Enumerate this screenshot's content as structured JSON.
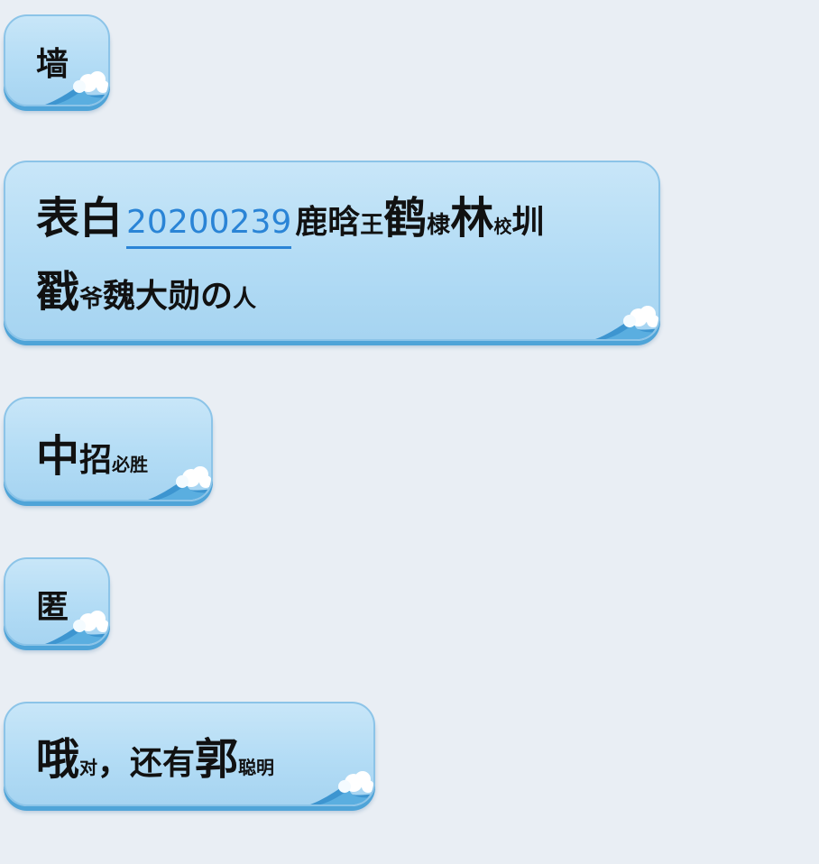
{
  "messages": [
    {
      "parts": [
        {
          "text": "墙",
          "size": "mid"
        }
      ]
    },
    {
      "line1": [
        {
          "text": "表白",
          "size": "big"
        },
        {
          "text": "20200239",
          "size": "link"
        },
        {
          "text": "鹿晗",
          "size": "mid"
        },
        {
          "text": "王",
          "size": "sm"
        },
        {
          "text": "鹤",
          "size": "big"
        },
        {
          "text": "棣",
          "size": "sm"
        },
        {
          "text": "林",
          "size": "big"
        },
        {
          "text": "校",
          "size": "xs"
        },
        {
          "text": "圳",
          "size": "mid"
        }
      ],
      "line2": [
        {
          "text": "戳",
          "size": "big"
        },
        {
          "text": "爷",
          "size": "sm"
        },
        {
          "text": "魏大勋",
          "size": "mid"
        },
        {
          "text": "の",
          "size": "mid"
        },
        {
          "text": "人",
          "size": "sm"
        }
      ]
    },
    {
      "parts": [
        {
          "text": "中",
          "size": "big"
        },
        {
          "text": "招",
          "size": "mid"
        },
        {
          "text": "必胜",
          "size": "xs"
        }
      ]
    },
    {
      "parts": [
        {
          "text": "匿",
          "size": "mid"
        }
      ]
    },
    {
      "parts": [
        {
          "text": "哦",
          "size": "big"
        },
        {
          "text": "对",
          "size": "xs"
        },
        {
          "text": "，",
          "size": "mid"
        },
        {
          "text": "还有",
          "size": "mid"
        },
        {
          "text": "郭",
          "size": "big"
        },
        {
          "text": "聪明",
          "size": "xs"
        }
      ]
    }
  ],
  "colors": {
    "background": "#e9eef4",
    "bubble": "#b3dcf5",
    "bubble_border": "#8cc4e8",
    "link": "#2a84d6"
  },
  "icons": {
    "bubble_decoration": "wave-cloud-icon"
  }
}
